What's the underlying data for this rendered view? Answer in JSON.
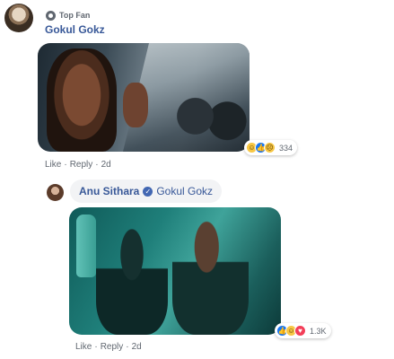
{
  "comment": {
    "badge": {
      "icon": "top-fan-badge-icon",
      "label": "Top Fan"
    },
    "author": "Gokul Gokz",
    "photo_description_icon": "image",
    "reactions": {
      "icons": [
        "haha",
        "like",
        "sad"
      ],
      "count": "334"
    },
    "actions": {
      "like": "Like",
      "separator": "·",
      "reply": "Reply",
      "time": "2d"
    }
  },
  "reply": {
    "author": "Anu Sithara",
    "verified_icon": "verified-check-icon",
    "mention": "Gokul Gokz",
    "reactions": {
      "icons": [
        "like",
        "haha",
        "love"
      ],
      "count": "1.3K"
    },
    "actions": {
      "like": "Like",
      "separator": "·",
      "reply": "Reply",
      "time": "2d"
    }
  },
  "colors": {
    "link_blue": "#385898",
    "meta_gray": "#606770",
    "bubble_bg": "#f2f3f5",
    "like_blue": "#1877f2",
    "love_red": "#f33e58",
    "haha_yellow": "#f7c744"
  }
}
